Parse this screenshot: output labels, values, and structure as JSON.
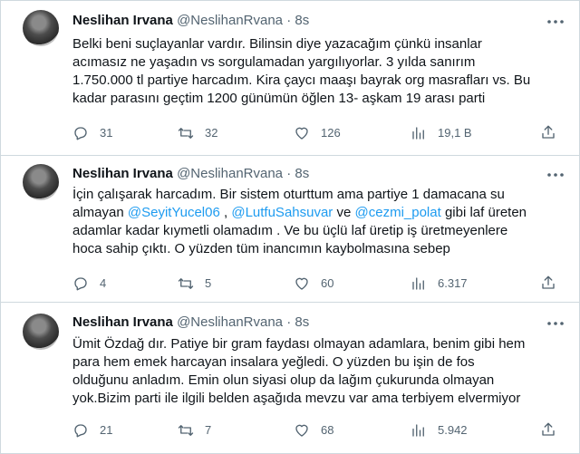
{
  "tweets": [
    {
      "name": "Neslihan Irvana",
      "handle": "@NeslihanRvana",
      "sep": "·",
      "time": "8s",
      "text": [
        "Belki beni suçlayanlar vardır. Bilinsin diye yazacağım çünkü insanlar",
        "acımasız ne yaşadın vs sorgulamadan yargılıyorlar. 3 yılda sanırım",
        "1.750.000 tl partiye harcadım. Kira çaycı maaşı bayrak org masrafları vs. Bu",
        "kadar parasını geçtim 1200 günümün öğlen 13- aşkam 19 arası parti"
      ],
      "replies": "31",
      "retweets": "32",
      "likes": "126",
      "views": "19,1 B"
    },
    {
      "name": "Neslihan Irvana",
      "handle": "@NeslihanRvana",
      "sep": "·",
      "time": "8s",
      "line1": "İçin çalışarak harcadım. Bir sistem oturttum ama partiye 1 damacana su",
      "line2_a": "almayan ",
      "mention1": "@SeyitYucel06",
      "line2_b": " , ",
      "mention2": "@LutfuSahsuvar",
      "line2_c": " ve ",
      "mention3": "@cezmi_polat",
      "line2_d": " gibi laf üreten",
      "line3": "adamlar kadar kıymetli olamadım . Ve bu üçlü laf üretip iş üretmeyenlere",
      "line4": "hoca sahip çıktı. O yüzden tüm inancımın kaybolmasına sebep",
      "replies": "4",
      "retweets": "5",
      "likes": "60",
      "views": "6.317"
    },
    {
      "name": "Neslihan Irvana",
      "handle": "@NeslihanRvana",
      "sep": "·",
      "time": "8s",
      "text": [
        "Ümit Özdağ dır. Patiye bir gram faydası olmayan adamlara, benim gibi hem",
        "para hem emek harcayan insalara yeğledi. O yüzden bu işin de fos",
        "olduğunu anladım. Emin olun siyasi olup da lağım çukurunda olmayan",
        "yok.Bizim parti ile ilgili belden aşağıda mevzu var ama terbiyem elvermiyor"
      ],
      "replies": "21",
      "retweets": "7",
      "likes": "68",
      "views": "5.942"
    }
  ],
  "icons": {
    "more": "more-icon",
    "reply": "reply-icon",
    "retweet": "retweet-icon",
    "like": "like-icon",
    "views": "views-icon",
    "share": "share-icon"
  },
  "colors": {
    "text": "#0f1419",
    "muted": "#536471",
    "mention": "#1d9bf0",
    "border": "#cfd9de"
  }
}
